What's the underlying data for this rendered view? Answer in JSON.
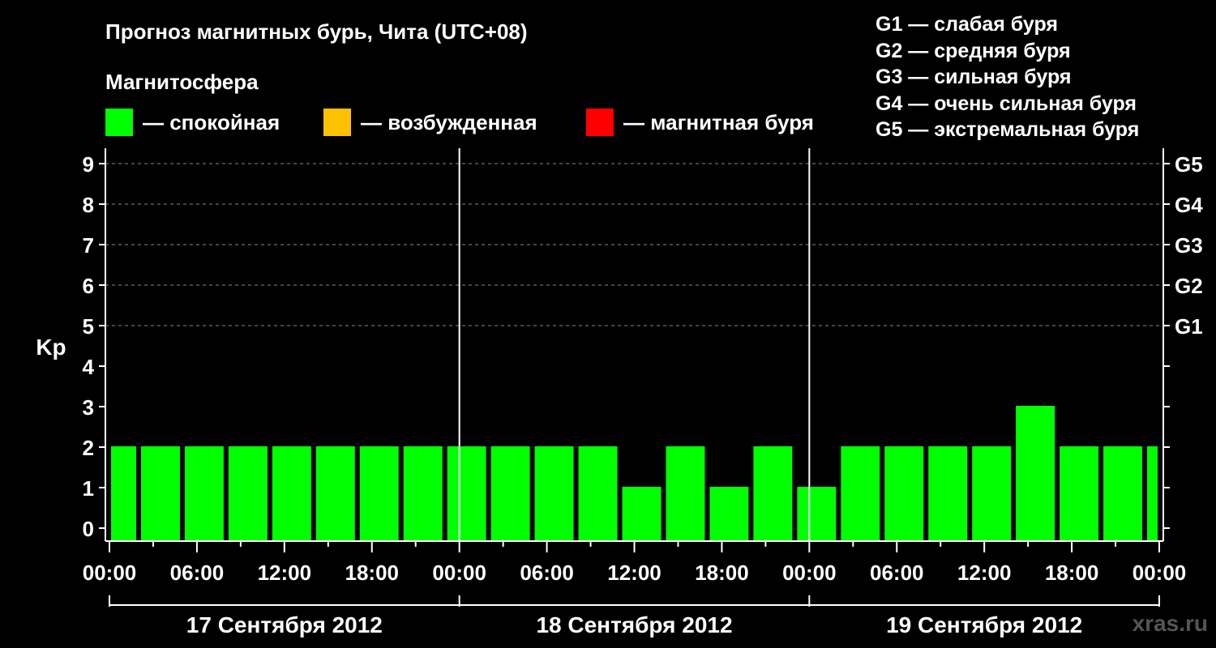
{
  "header": {
    "title": "Прогноз магнитных бурь, Чита (UTC+08)",
    "subtitle": "Магнитосфера"
  },
  "legend": [
    {
      "label": "— спокойная",
      "color": "#00ff00"
    },
    {
      "label": "— возбужденная",
      "color": "#ffc000"
    },
    {
      "label": "— магнитная буря",
      "color": "#ff0000"
    }
  ],
  "storm_levels": [
    "G1 — слабая буря",
    "G2 — средняя буря",
    "G3 — сильная буря",
    "G4 — очень сильная буря",
    "G5 — экстремальная буря"
  ],
  "watermark": "xras.ru",
  "chart_data": {
    "type": "bar",
    "title": "Прогноз магнитных бурь, Чита (UTC+08)",
    "ylabel": "Kp",
    "ylim": [
      0,
      9
    ],
    "y_ticks": [
      "0",
      "1",
      "2",
      "3",
      "4",
      "5",
      "6",
      "7",
      "8",
      "9"
    ],
    "right_ticks": [
      {
        "kp": 5,
        "label": "G1"
      },
      {
        "kp": 6,
        "label": "G2"
      },
      {
        "kp": 7,
        "label": "G3"
      },
      {
        "kp": 8,
        "label": "G4"
      },
      {
        "kp": 9,
        "label": "G5"
      }
    ],
    "grid": "horizontal dashed at Kp 5–9",
    "x_tick_labels": [
      "00:00",
      "06:00",
      "12:00",
      "18:00",
      "00:00",
      "06:00",
      "12:00",
      "18:00",
      "00:00",
      "06:00",
      "12:00",
      "18:00",
      "00:00"
    ],
    "days": [
      "17 Сентября 2012",
      "18 Сентября 2012",
      "19 Сентября 2012"
    ],
    "bar_interval_hours": 3,
    "start_hour_offset": -1,
    "values": [
      2,
      2,
      2,
      2,
      2,
      2,
      2,
      2,
      2,
      2,
      2,
      2,
      1,
      2,
      1,
      2,
      1,
      2,
      2,
      2,
      2,
      3,
      2,
      2,
      2
    ],
    "color": "#00ff00"
  }
}
